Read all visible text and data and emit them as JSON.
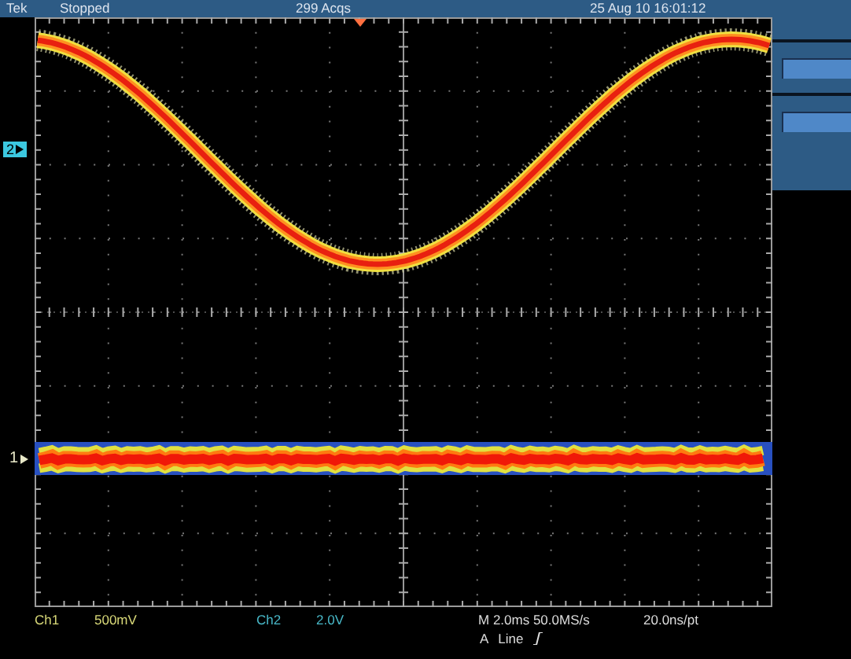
{
  "status_bar": {
    "brand": "Tek",
    "state": "Stopped",
    "acquisitions": "299 Acqs",
    "datetime": "25 Aug 10 16:01:12"
  },
  "markers": [
    {
      "label": "2",
      "kind": "boxed",
      "color": "#3cc8e0"
    },
    {
      "label": "1",
      "kind": "plain",
      "color": "#e8e8c8"
    }
  ],
  "channels": [
    {
      "name": "Ch1",
      "scale": "500mV",
      "color": "#d8d878"
    },
    {
      "name": "Ch2",
      "scale": "2.0V",
      "color": "#48b8c8"
    }
  ],
  "timebase": {
    "horizontal": "M 2.0ms 50.0MS/s",
    "resolution": "20.0ns/pt"
  },
  "trigger": {
    "source": "A",
    "type": "Line",
    "rising_edge": true
  }
}
